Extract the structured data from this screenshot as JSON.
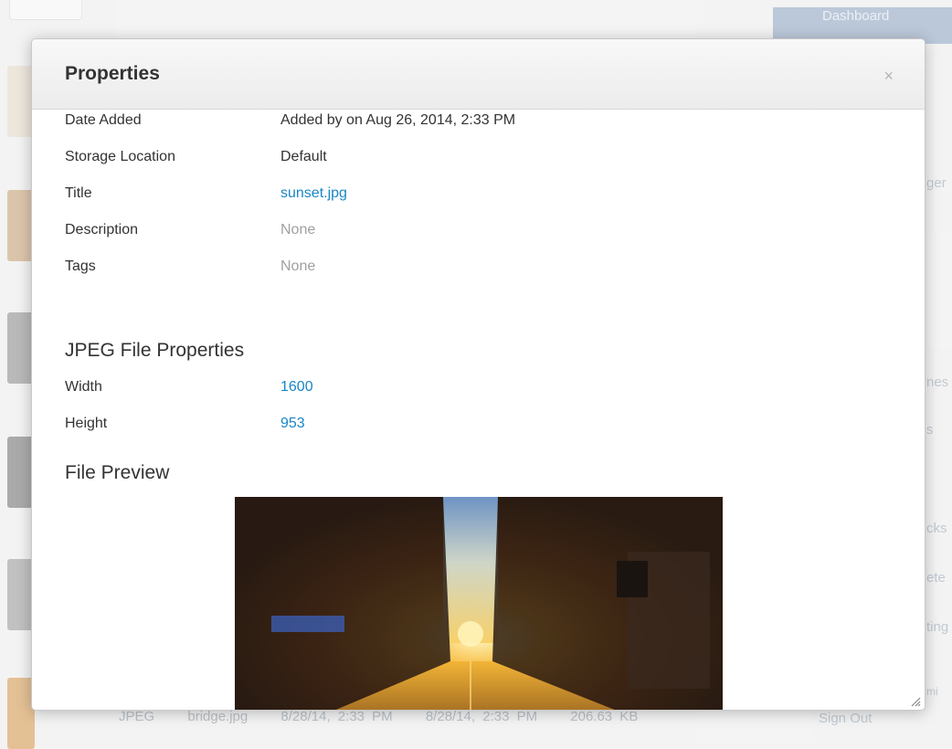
{
  "background": {
    "dashboard_label": "Dashboard",
    "side_fragments": [
      "ger",
      "nes",
      "s",
      "cks",
      "ete",
      "ting",
      "mi"
    ],
    "row": {
      "type": "JPEG",
      "name": "bridge.jpg",
      "added": "8/28/14, 2:33 PM",
      "modified": "8/28/14, 2:33 PM",
      "size": "206.63 KB"
    },
    "sign_out": "Sign Out"
  },
  "modal": {
    "title": "Properties",
    "close_icon": "×",
    "properties": [
      {
        "label": "Date Added",
        "value": "Added by on Aug 26, 2014, 2:33 PM"
      },
      {
        "label": "Storage Location",
        "value": "Default"
      },
      {
        "label": "Title",
        "value": "sunset.jpg"
      },
      {
        "label": "Description",
        "value": "None"
      },
      {
        "label": "Tags",
        "value": "None"
      }
    ],
    "jpeg_heading": "JPEG File Properties",
    "jpeg_properties": [
      {
        "label": "Width",
        "value": "1600"
      },
      {
        "label": "Height",
        "value": "953"
      }
    ],
    "preview_heading": "File Preview"
  },
  "colors": {
    "link": "#1a86c7",
    "muted": "#a0a0a0",
    "text": "#333333"
  },
  "icons": {
    "close": "close-icon",
    "resize": "resize-grip-icon"
  }
}
